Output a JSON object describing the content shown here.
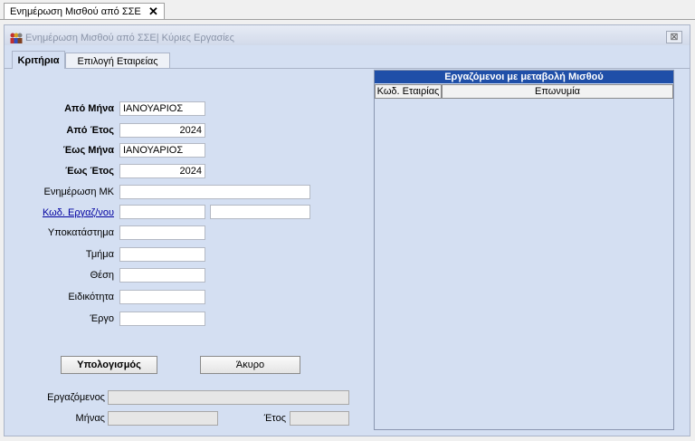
{
  "doc_tab": {
    "label": "Ενημέρωση Μισθού από ΣΣΕ",
    "close_glyph": "✕"
  },
  "window": {
    "title": "Ενημέρωση Μισθού από ΣΣΕ| Κύριες Εργασίες",
    "close_glyph": "⊠"
  },
  "tabs": [
    {
      "label": "Κριτήρια",
      "active": true
    },
    {
      "label": "Επιλογή Εταιρείας",
      "active": false
    }
  ],
  "form": {
    "apo_mina_label": "Από Μήνα",
    "apo_mina_value": "ΙΑΝΟΥΑΡΙΟΣ",
    "apo_etos_label": "Από Έτος",
    "apo_etos_value": "2024",
    "eos_mina_label": "Έως Μήνα",
    "eos_mina_value": "ΙΑΝΟΥΑΡΙΟΣ",
    "eos_etos_label": "Έως Έτος",
    "eos_etos_value": "2024",
    "enimerosi_mk_label": "Ενημέρωση ΜΚ",
    "enimerosi_mk_value": "",
    "kod_ergaz_label": "Κωδ. Εργαζ/νου",
    "kod_ergaz_value": "",
    "kod_ergaz_name": "",
    "ypokatastima_label": "Υποκατάστημα",
    "ypokatastima_value": "",
    "tmima_label": "Τμήμα",
    "tmima_value": "",
    "thesi_label": "Θέση",
    "thesi_value": "",
    "eidikotita_label": "Ειδικότητα",
    "eidikotita_value": "",
    "ergo_label": "Έργο",
    "ergo_value": ""
  },
  "buttons": {
    "calculate": "Υπολογισμός",
    "cancel": "Άκυρο"
  },
  "progress": {
    "employee_label": "Εργαζόμενος",
    "employee_value": "",
    "month_label": "Μήνας",
    "month_value": "",
    "year_label": "Έτος",
    "year_value": ""
  },
  "grid": {
    "title": "Εργαζόμενοι με μεταβολή Μισθού",
    "columns": [
      "Κωδ. Εταιρίας",
      "Επωνυμία"
    ],
    "rows": []
  },
  "colors": {
    "panel": "#d4dff2",
    "grid_header": "#1f4fa8"
  }
}
